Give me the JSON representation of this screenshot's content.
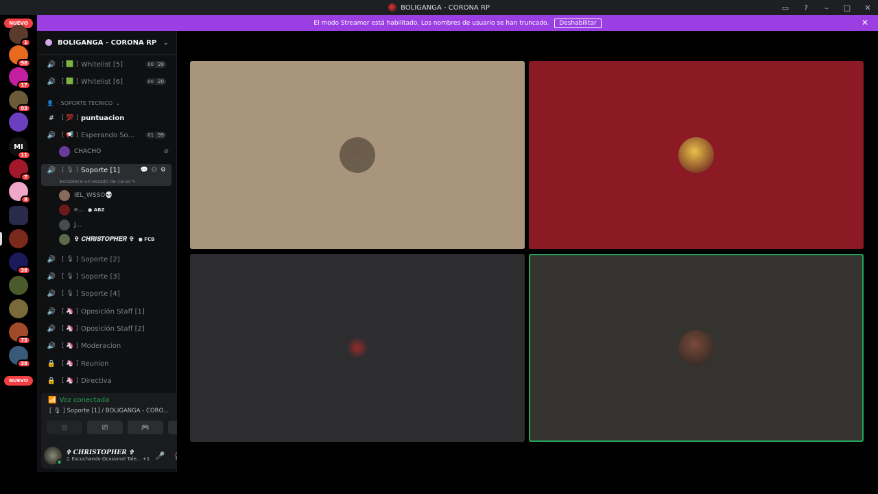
{
  "window": {
    "title": "BOLIGANGA - CORONA RP",
    "controls": [
      "inbox-icon",
      "help-icon",
      "minimize-icon",
      "maximize-icon",
      "close-icon"
    ]
  },
  "banner": {
    "message": "El modo Streamer está habilitado. Los nombres de usuario se han truncado.",
    "button": "Deshabilitar"
  },
  "rail": {
    "nuevo_top": "NUEVO",
    "nuevo_bottom": "NUEVO",
    "servers": [
      {
        "badge": "1",
        "color": "#5a3a2a"
      },
      {
        "badge": "96",
        "color": "#e86a1e"
      },
      {
        "badge": "17",
        "color": "#c41fa0"
      },
      {
        "badge": "93",
        "color": "#6b5a3a"
      },
      {
        "badge": "",
        "color": "#6b3fbf"
      },
      {
        "badge": "11",
        "color": "#111111",
        "text": "MI"
      },
      {
        "badge": "7",
        "color": "#a0182a"
      },
      {
        "badge": "8",
        "color": "#f0a8c8"
      },
      {
        "badge": "",
        "color": "#2a2a4a",
        "folder": true
      },
      {
        "badge": "",
        "color": "#7a2a1a"
      },
      {
        "badge": "38",
        "color": "#1a1a5a"
      },
      {
        "badge": "",
        "color": "#4a5a2a"
      },
      {
        "badge": "",
        "color": "#7a6a3a"
      },
      {
        "badge": "75",
        "color": "#a04a2a"
      },
      {
        "badge": "38",
        "color": "#3a5a7a"
      }
    ]
  },
  "sidebar": {
    "guild_name": "BOLIGANGA - CORONA RP",
    "category": "SOPORTE TECNICO",
    "channels": {
      "whitelist5": {
        "name": "Whitelist [5]",
        "c1": "00",
        "c2": "20"
      },
      "whitelist6": {
        "name": "Whitelist [6]",
        "c1": "00",
        "c2": "20"
      },
      "puntuacion": {
        "name": "puntuacion"
      },
      "esperando": {
        "name": "Esperando So...",
        "c1": "01",
        "c2": "99"
      },
      "chacho": {
        "name": "CHACHO"
      },
      "soporte1": {
        "name": "Soporte [1]",
        "status": "Establece un estado de canal"
      },
      "soporte2": {
        "name": "Soporte [2]"
      },
      "soporte3": {
        "name": "Soporte [3]"
      },
      "soporte4": {
        "name": "Soporte [4]"
      },
      "oposicion1": {
        "name": "Oposición Staff [1]"
      },
      "oposicion2": {
        "name": "Oposición Staff [2]"
      },
      "moderacion": {
        "name": "Moderacion"
      },
      "reunion": {
        "name": "Reunion"
      },
      "directiva": {
        "name": "Directiva"
      }
    },
    "members": [
      {
        "name": "IEL_WSSO💀",
        "tag": "",
        "color": "#8a6a5a"
      },
      {
        "name": "e...",
        "tag": "ABZ",
        "color": "#6a1a1a"
      },
      {
        "name": "J...",
        "tag": "",
        "color": "#4a4a4a"
      },
      {
        "name": "✞ 𝑪𝑯𝑹𝑰𝑺𝑻𝑶𝑷𝑯𝑬𝑹 ✞",
        "tag": "FCB",
        "color": "#5a6a4a"
      }
    ]
  },
  "voice": {
    "status": "Voz conectada",
    "channel": "[ 🎙 ] Soporte [1] / BOLIGANGA - CORO...",
    "user_name": "✞ 𝑪𝑯𝑹𝑰𝑺𝑻𝑶𝑷𝑯𝑬𝑹 ✞",
    "activity": "Escuchando Ocasional Tale...",
    "activity_extra": "+1"
  },
  "tiles": [
    {
      "bg": "#a8957c",
      "avatar": "#6a5a4a",
      "speaking": false
    },
    {
      "bg": "#8b1a25",
      "avatar": "#e8c04a",
      "speaking": false
    },
    {
      "bg": "#2d2d30",
      "avatar": "#3a2a2a",
      "speaking": false
    },
    {
      "bg": "#35332f",
      "avatar": "#7a4a3a",
      "speaking": true
    }
  ]
}
